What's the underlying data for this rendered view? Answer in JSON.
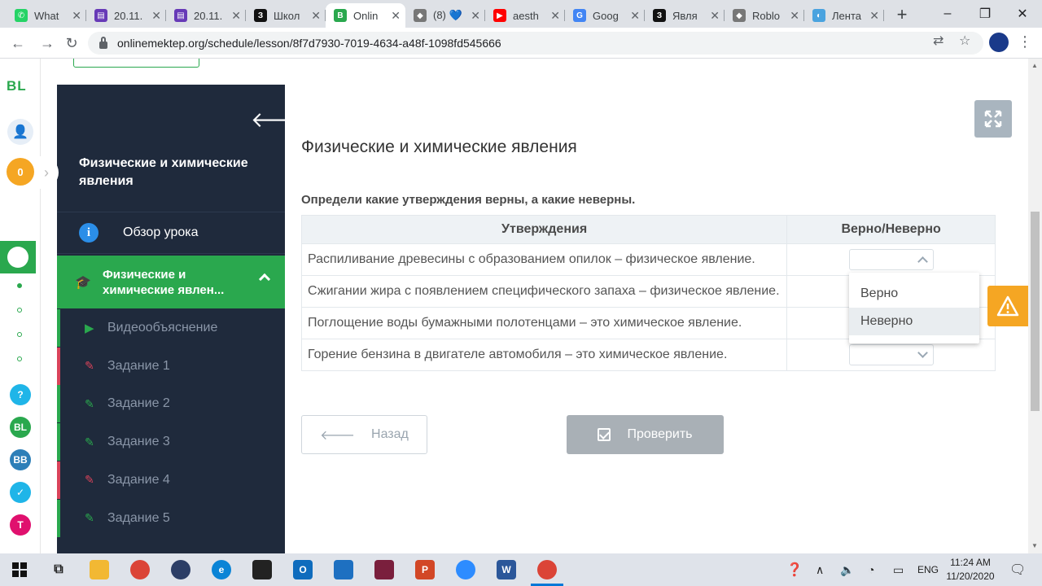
{
  "browser": {
    "tabs": [
      {
        "label": "What",
        "favicon_color": "#25d366",
        "glyph": "✆"
      },
      {
        "label": "20.11.",
        "favicon_color": "#673ab7",
        "glyph": "▤"
      },
      {
        "label": "20.11.",
        "favicon_color": "#673ab7",
        "glyph": "▤"
      },
      {
        "label": "Школ",
        "favicon_color": "#111111",
        "glyph": "З"
      },
      {
        "label": "Onlin",
        "favicon_color": "#2aa84e",
        "glyph": "B",
        "active": true
      },
      {
        "label": "(8) 💙",
        "favicon_color": "#777777",
        "glyph": "◆"
      },
      {
        "label": "aesth",
        "favicon_color": "#ff0000",
        "glyph": "▶"
      },
      {
        "label": "Goog",
        "favicon_color": "#4285f4",
        "glyph": "G"
      },
      {
        "label": "Явля",
        "favicon_color": "#111111",
        "glyph": "З"
      },
      {
        "label": "Roblo",
        "favicon_color": "#777777",
        "glyph": "◆"
      },
      {
        "label": "Лента",
        "favicon_color": "#4aa3df",
        "glyph": "◐"
      }
    ],
    "url": "onlinemektep.org/schedule/lesson/8f7d7930-7019-4634-a48f-1098fd545666",
    "window_controls": [
      "–",
      "❐",
      "✕"
    ]
  },
  "rail": {
    "logo": "BL",
    "coins": "0",
    "icons": [
      {
        "name": "help",
        "color": "#1fb5e8",
        "glyph": "?"
      },
      {
        "name": "bilim-land",
        "color": "#2aa84e",
        "glyph": "BL"
      },
      {
        "name": "bilim-book",
        "color": "#2d7fb8",
        "glyph": "BB"
      },
      {
        "name": "test",
        "color": "#1fb5e8",
        "glyph": "✓"
      },
      {
        "name": "twig",
        "color": "#e0106e",
        "glyph": "T"
      }
    ]
  },
  "sidebar": {
    "title": "Физические и химические явления",
    "overview_label": "Обзор урока",
    "active_section": "Физические и химические явлен...",
    "items": [
      {
        "label": "Видеообъяснение",
        "icon": "play-icon",
        "status": "green"
      },
      {
        "label": "Задание 1",
        "icon": "edit-icon",
        "status": "red"
      },
      {
        "label": "Задание 2",
        "icon": "edit-icon",
        "status": "green"
      },
      {
        "label": "Задание 3",
        "icon": "edit-icon",
        "status": "green"
      },
      {
        "label": "Задание 4",
        "icon": "edit-icon",
        "status": "red"
      },
      {
        "label": "Задание 5",
        "icon": "edit-icon",
        "status": "green"
      }
    ]
  },
  "main": {
    "title": "Физические и химические явления",
    "question": "Определи какие утверждения верны, а какие неверны.",
    "table": {
      "headers": [
        "Утверждения",
        "Верно/Неверно"
      ],
      "rows": [
        {
          "statement": "Распиливание древесины с образованием опилок – физическое явление.",
          "value": ""
        },
        {
          "statement": "Сжигании жира с появлением специфического запаха – физическое явление.",
          "value": ""
        },
        {
          "statement": "Поглощение воды бумажными полотенцами – это химическое явление.",
          "value": ""
        },
        {
          "statement": "Горение бензина в двигателе автомобиля – это химическое явление.",
          "value": ""
        }
      ]
    },
    "dropdown_options": [
      "Верно",
      "Неверно"
    ],
    "hovered_option": "Неверно",
    "back_button": "Назад",
    "check_button": "Проверить"
  },
  "taskbar": {
    "language": "ENG",
    "time": "11:24 AM",
    "date": "11/20/2020"
  }
}
